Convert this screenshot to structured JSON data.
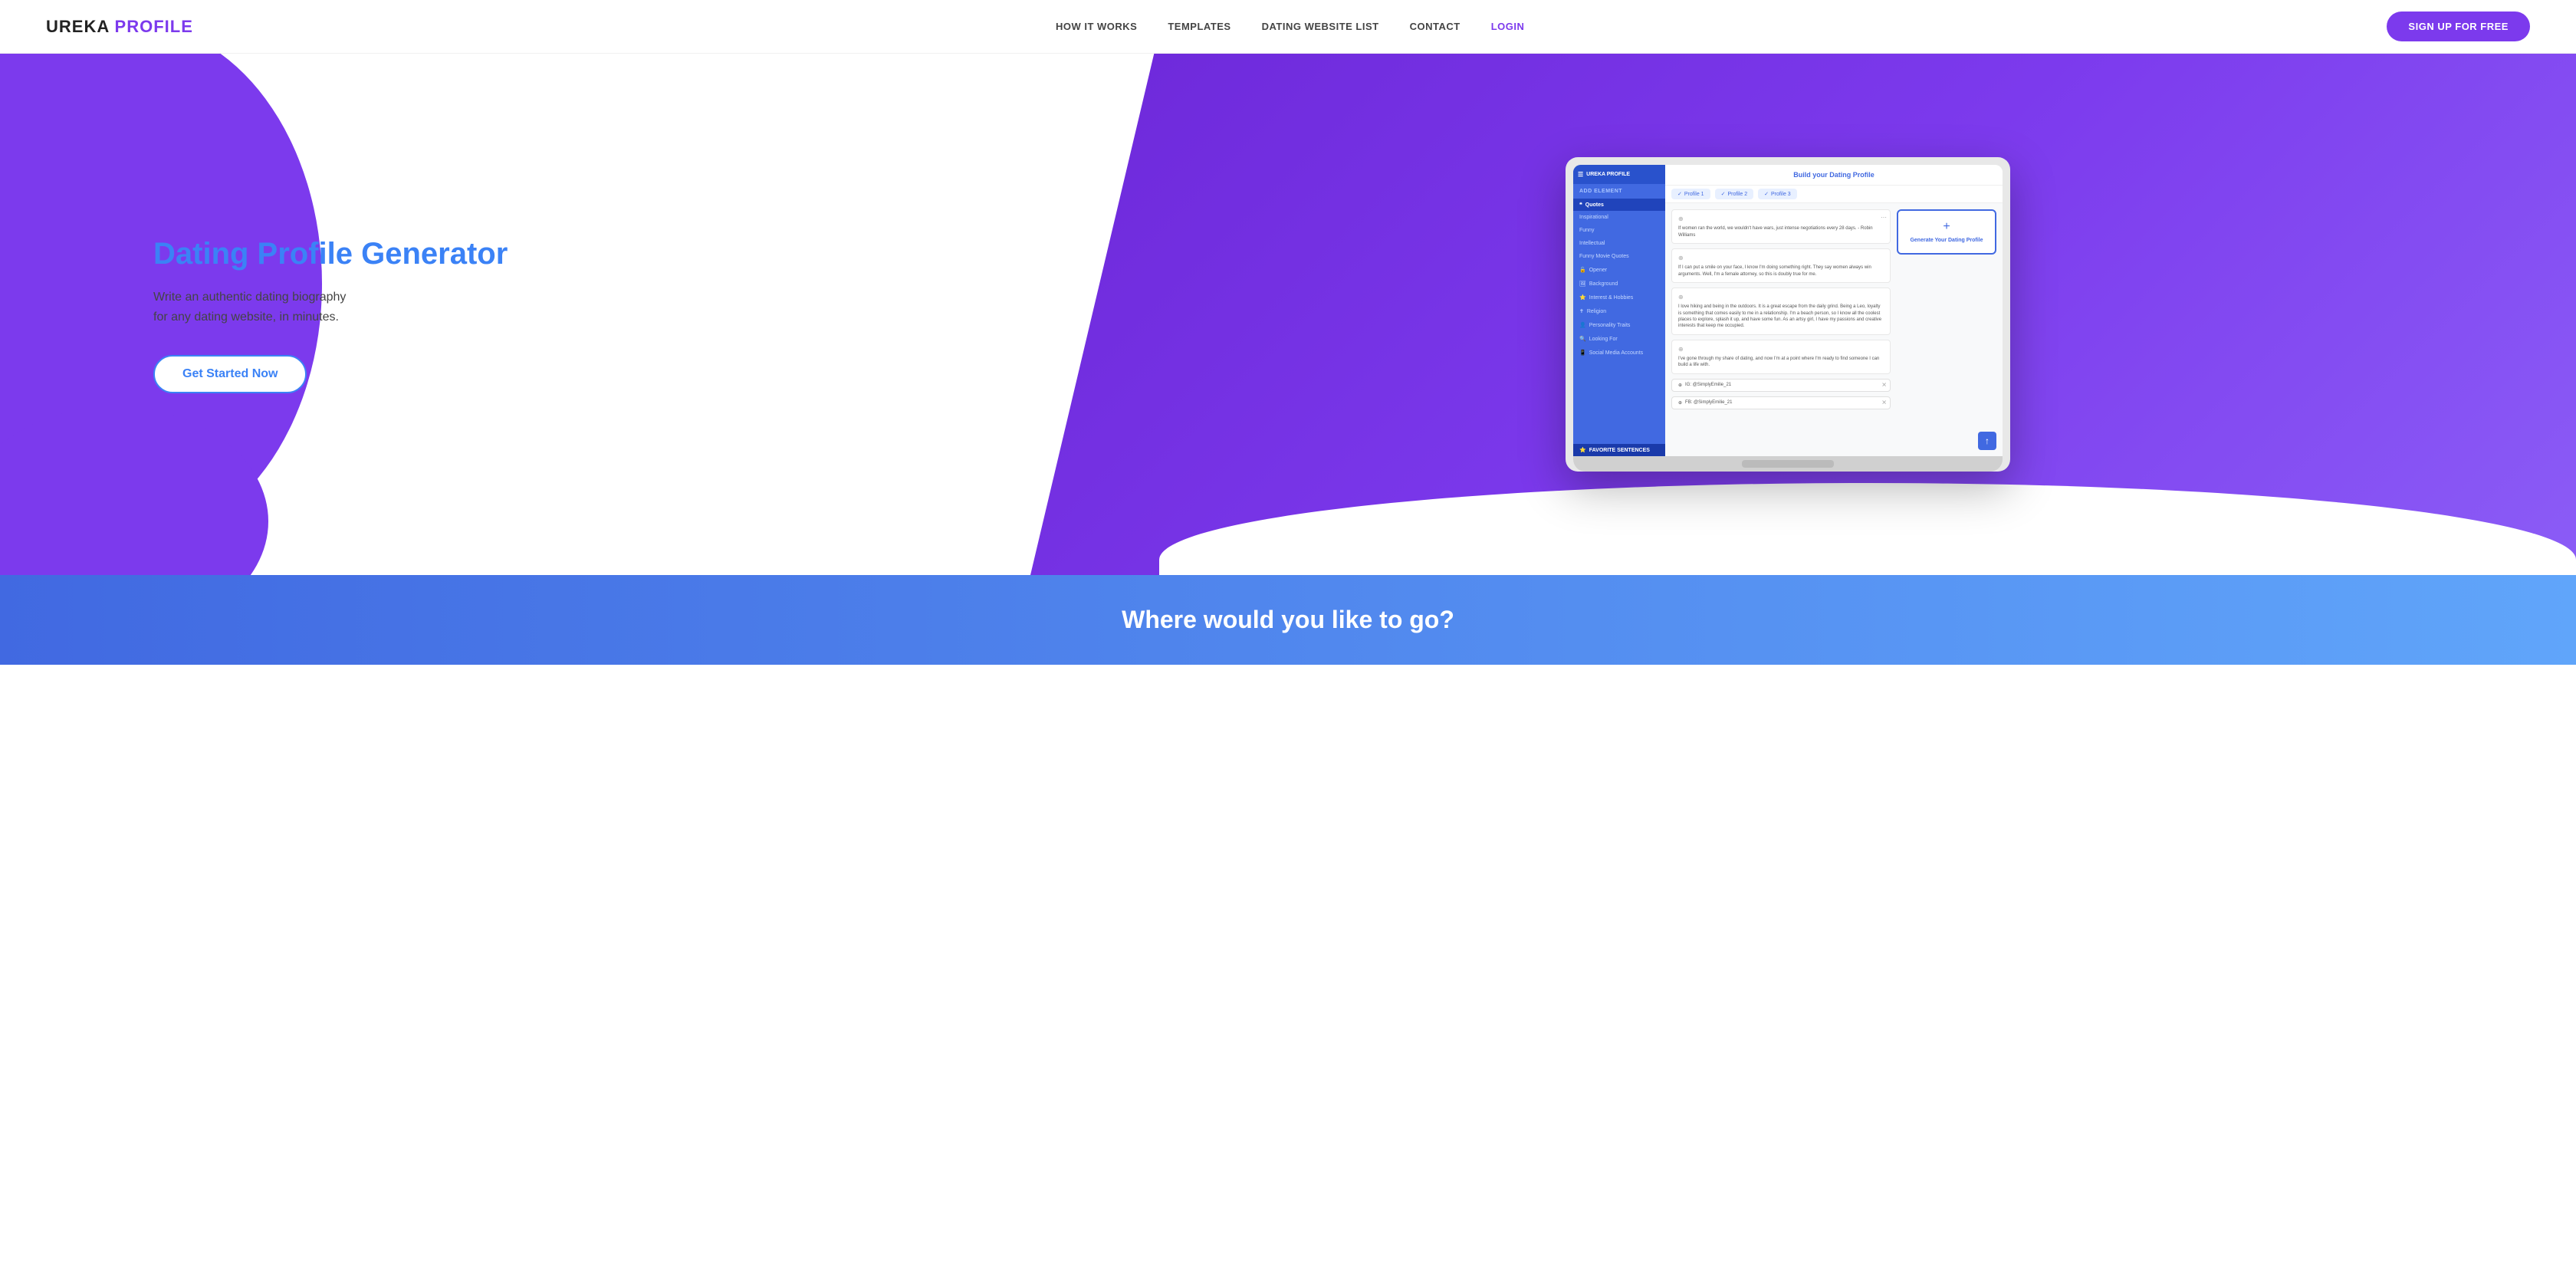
{
  "logo": {
    "ureka": "UREKA",
    "profile": "PROFILE"
  },
  "nav": {
    "links": [
      {
        "id": "how-it-works",
        "label": "HOW IT WORKS"
      },
      {
        "id": "templates",
        "label": "TEMPLATES"
      },
      {
        "id": "dating-website-list",
        "label": "DATING WEBSITE LIST"
      },
      {
        "id": "contact",
        "label": "CONTACT"
      },
      {
        "id": "login",
        "label": "LOGIN",
        "class": "login"
      }
    ],
    "signup_label": "SIGN UP FOR FREE"
  },
  "hero": {
    "title": "Dating Profile Generator",
    "subtitle": "Write an authentic dating biography\nfor any dating website, in minutes.",
    "cta_label": "Get Started Now"
  },
  "app": {
    "header_title": "Build your Dating Profile",
    "sidebar_brand": "UREKA PROFILE",
    "add_element": "ADD ELEMENT",
    "tabs": [
      "Profile 1",
      "Profile 2",
      "Profile 3"
    ],
    "sidebar_items": [
      {
        "label": "Quotes",
        "icon": "❝",
        "active": true
      },
      {
        "label": "Inspirational",
        "sub": true
      },
      {
        "label": "Funny",
        "sub": true
      },
      {
        "label": "Intellectual",
        "sub": true
      },
      {
        "label": "Funny Movie Quotes",
        "sub": true
      },
      {
        "label": "Opener",
        "icon": "🔓"
      },
      {
        "label": "Background",
        "icon": "🖼"
      },
      {
        "label": "Interest & Hobbies",
        "icon": "⭐"
      },
      {
        "label": "Religion",
        "icon": "✝"
      },
      {
        "label": "Personality Traits",
        "icon": "👤"
      },
      {
        "label": "Looking For",
        "icon": "🔍"
      },
      {
        "label": "Social Media Accounts",
        "icon": "📱"
      },
      {
        "label": "FAVORITE SENTENCES",
        "icon": "⭐",
        "active_bottom": true
      }
    ],
    "editor_blocks": [
      {
        "text": "If women ran the world, we wouldn't have wars, just intense negotiations every 28 days. - Robin Williams"
      },
      {
        "text": "If I can put a smile on your face, I know I'm doing something right. They say women always win arguments. Well, I'm a female attorney, so this is doubly true for me."
      },
      {
        "text": "I love hiking and being in the outdoors. It is a great escape from the daily grind. Being a Leo, loyalty is something that comes easily to me in a relationship. I'm a beach person, so I know all the coolest places to explore, splash it up, and have some fun. As an artsy girl, I have my passions and creative interests that keep me occupied."
      },
      {
        "text": "I've gone through my share of dating, and now I'm at a point where I'm ready to find someone I can build a life with."
      }
    ],
    "social_rows": [
      "IG: @SimplyEmilie_21",
      "FB: @SimplyEmilie_21"
    ],
    "generate_label": "Generate Your Dating Profile",
    "upload_icon": "↑"
  },
  "bottom": {
    "title": "Where would you like to go?"
  }
}
